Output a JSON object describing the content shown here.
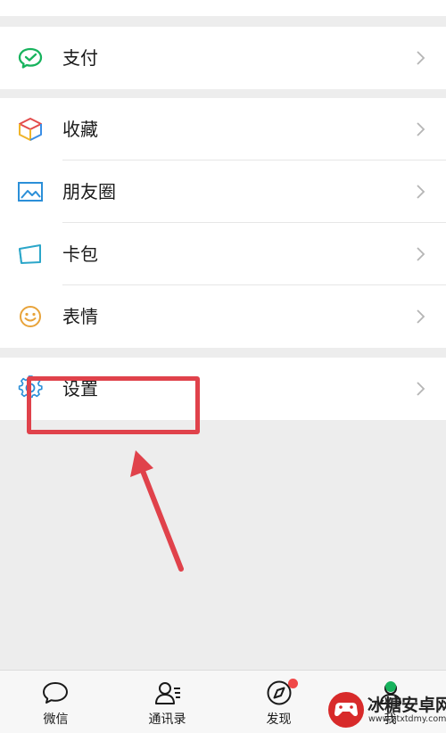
{
  "menu": {
    "pay": {
      "label": "支付",
      "icon": "pay-icon"
    },
    "favorites": {
      "label": "收藏",
      "icon": "cube-icon"
    },
    "moments": {
      "label": "朋友圈",
      "icon": "picture-icon"
    },
    "cards": {
      "label": "卡包",
      "icon": "card-icon"
    },
    "stickers": {
      "label": "表情",
      "icon": "smiley-icon"
    },
    "settings": {
      "label": "设置",
      "icon": "gear-icon"
    }
  },
  "tabbar": {
    "tabs": [
      {
        "label": "微信",
        "icon": "chat-bubble-icon"
      },
      {
        "label": "通讯录",
        "icon": "contacts-icon"
      },
      {
        "label": "发现",
        "icon": "compass-icon"
      },
      {
        "label": "我",
        "icon": "person-icon"
      }
    ]
  },
  "watermark": {
    "title": "冰糖安卓网",
    "url": "www.btxtdmy.com"
  },
  "colors": {
    "accent_green": "#17b35d",
    "highlight_red": "#e0424b",
    "background": "#ededed"
  }
}
